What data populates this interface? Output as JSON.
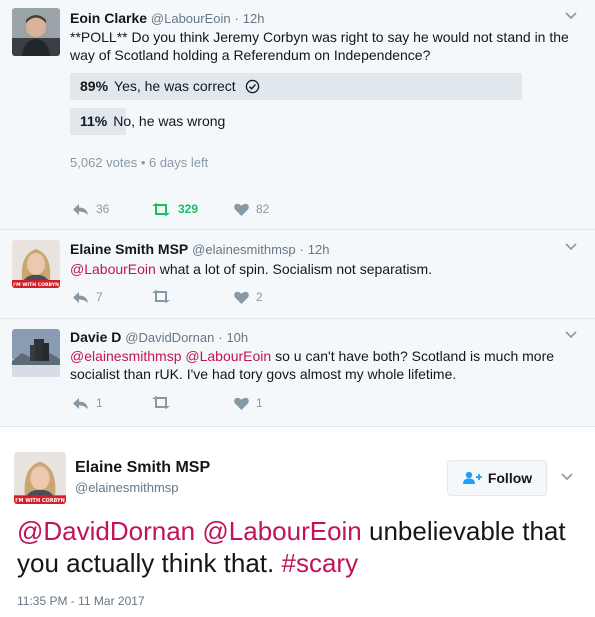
{
  "tweets": [
    {
      "name": "Eoin Clarke",
      "handle": "@LabourEoin",
      "time": "12h",
      "text": "**POLL** Do you think Jeremy Corbyn was right to say he would not stand in the way of Scotland holding a Referendum on Independence?",
      "poll": {
        "options": [
          {
            "percent": "89%",
            "label": "Yes, he was correct",
            "value": 89,
            "winner": true
          },
          {
            "percent": "11%",
            "label": "No, he was wrong",
            "value": 11,
            "winner": false
          }
        ],
        "meta": "5,062 votes • 6 days left"
      },
      "actions": {
        "replies": "36",
        "retweets": "329",
        "likes": "82"
      }
    },
    {
      "name": "Elaine Smith MSP",
      "handle": "@elainesmithmsp",
      "time": "12h",
      "mention": "@LabourEoin",
      "text": "what a lot of spin. Socialism not separatism.",
      "avatar_badge": "I'M WITH CORBYN",
      "actions": {
        "replies": "7",
        "retweets": "",
        "likes": "2"
      }
    },
    {
      "name": "Davie D",
      "handle": "@DavidDornan",
      "time": "10h",
      "mention1": "@elainesmithmsp",
      "mention2": "@LabourEoin",
      "text": "so u can't have both? Scotland is much more socialist than rUK. I've had tory govs almost my whole lifetime.",
      "actions": {
        "replies": "1",
        "retweets": "",
        "likes": "1"
      }
    }
  ],
  "main_tweet": {
    "name": "Elaine Smith MSP",
    "handle": "@elainesmithmsp",
    "avatar_badge": "I'M WITH CORBYN",
    "follow_label": "Follow",
    "mention1": "@DavidDornan",
    "mention2": "@LabourEoin",
    "text": "unbelievable that you actually think that.",
    "hashtag": "#scary",
    "timestamp": "11:35 PM - 11 Mar 2017"
  },
  "colors": {
    "link": "#c0135a",
    "retweet_active": "#17bf63",
    "muted": "#8899a6",
    "background": "#f5f8fa"
  },
  "icons": [
    "reply-icon",
    "retweet-icon",
    "heart-icon",
    "chevron-down-icon",
    "check-circle-icon",
    "follow-user-icon"
  ]
}
